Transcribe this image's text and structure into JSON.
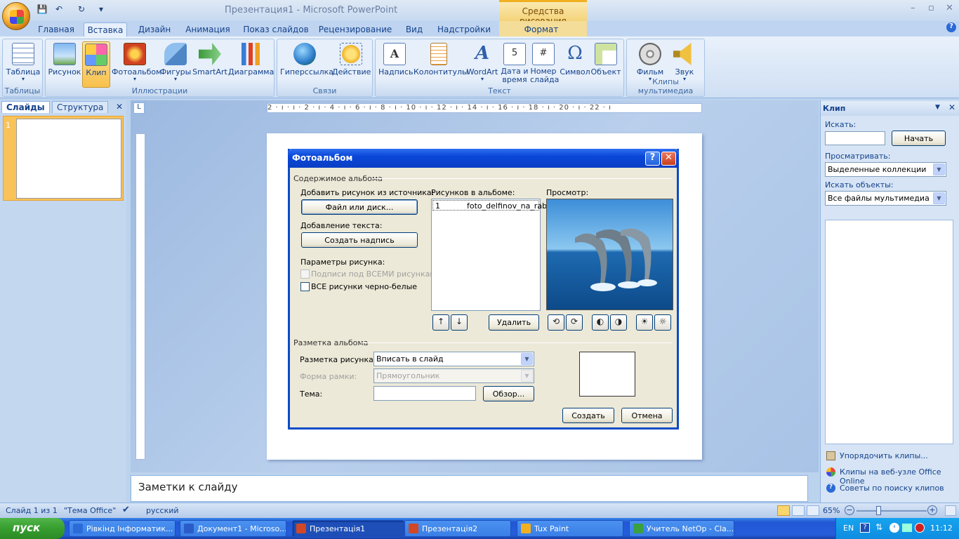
{
  "window": {
    "title": "Презентация1 - Microsoft PowerPoint",
    "context_tab_group": "Средства рисования",
    "controls": [
      "–",
      "▫",
      "✕"
    ]
  },
  "qat": {
    "save": "💾",
    "undo": "↶",
    "redo": "↻",
    "more": "▾"
  },
  "tabs": [
    {
      "label": "Главная"
    },
    {
      "label": "Вставка"
    },
    {
      "label": "Дизайн"
    },
    {
      "label": "Анимация"
    },
    {
      "label": "Показ слайдов"
    },
    {
      "label": "Рецензирование"
    },
    {
      "label": "Вид"
    },
    {
      "label": "Надстройки"
    },
    {
      "label": "Формат"
    }
  ],
  "help_icon": "?",
  "ribbon": {
    "tables": {
      "label": "Таблицы",
      "table": "Таблица"
    },
    "illustrations": {
      "label": "Иллюстрации",
      "picture": "Рисунок",
      "clip": "Клип",
      "album": "Фотоальбом",
      "shapes": "Фигуры",
      "smartart": "SmartArt",
      "chart": "Диаграмма"
    },
    "links": {
      "label": "Связи",
      "hyperlink": "Гиперссылка",
      "action": "Действие"
    },
    "text": {
      "label": "Текст",
      "textbox": "Надпись",
      "header": "Колонтитулы",
      "wordart": "WordArt",
      "date1": "Дата и",
      "date2": "время",
      "num1": "Номер",
      "num2": "слайда",
      "symbol": "Символ",
      "object": "Объект"
    },
    "media": {
      "label": "Клипы мультимедиа",
      "movie": "Фильм",
      "sound": "Звук"
    }
  },
  "left_pane": {
    "tab_slides": "Слайды",
    "tab_outline": "Структура",
    "close": "✕",
    "slide_num": "1"
  },
  "ruler": {
    "corner": "L",
    "h_ticks": "2 · ı · ı · 2 · ı · 4 · ı · 6 · ı · 8 · ı · 10 · ı · 12 · ı · 14 · ı · 16 · ı · 18 · ı · 20 · ı · 22 · ı"
  },
  "dialog": {
    "title": "Фотоальбом",
    "help": "?",
    "close": "✕",
    "section_content": "Содержимое альбома",
    "add_from": "Добавить рисунок из источника:",
    "file_button": "Файл или диск...",
    "add_text": "Добавление текста:",
    "create_caption": "Создать надпись",
    "picture_options": "Параметры рисунка:",
    "captions_all": "Подписи под ВСЕМИ рисунками",
    "all_bw": "ВСЕ рисунки черно-белые",
    "pictures_label": "Рисунков в альбоме:",
    "pictures": [
      {
        "num": "1",
        "name": "foto_delfinov_na_rab"
      }
    ],
    "preview_label": "Просмотр:",
    "move_up": "↑",
    "move_down": "↓",
    "remove": "Удалить",
    "tools": [
      "⟲",
      "⟳",
      "◐",
      "◑",
      "☀",
      "☼"
    ],
    "section_layout": "Разметка альбома",
    "layout_label": "Разметка рисунка:",
    "layout_value": "Вписать в слайд",
    "frame_label": "Форма рамки:",
    "frame_value": "Прямоугольник",
    "theme_label": "Тема:",
    "theme_value": "",
    "browse": "Обзор...",
    "create": "Создать",
    "cancel": "Отмена"
  },
  "clip_pane": {
    "title": "Клип",
    "search_label": "Искать:",
    "search_value": "",
    "go": "Начать",
    "look_in_label": "Просматривать:",
    "look_in_value": "Выделенные коллекции",
    "types_label": "Искать объекты:",
    "types_value": "Все файлы мультимедиа",
    "link_organize": "Упорядочить клипы...",
    "link_online": "Клипы на веб-узле Office Online",
    "link_tips": "Советы по поиску клипов"
  },
  "notes_placeholder": "Заметки к слайду",
  "status": {
    "slide": "Слайд 1 из 1",
    "theme": "\"Тема Office\"",
    "lang": "русский",
    "zoom": "65%"
  },
  "taskbar": {
    "start": "пуск",
    "items": [
      {
        "label": "Рівкінд Інформатик...",
        "color": "#2b6bd8"
      },
      {
        "label": "Документ1 - Microso...",
        "color": "#2a5cc9"
      },
      {
        "label": "Презентація1",
        "color": "#d24726"
      },
      {
        "label": "Презентація2",
        "color": "#d24726"
      },
      {
        "label": "Tux Paint",
        "color": "#f0b020"
      },
      {
        "label": "Учитель NetOp - Cla...",
        "color": "#3aa040"
      }
    ],
    "lang": "EN",
    "clock": "11:12"
  },
  "colors": {
    "accent": "#15428b",
    "dialog_title": "#0a47d8",
    "selected": "#f7c04a",
    "taskbar": "#245ddb"
  }
}
